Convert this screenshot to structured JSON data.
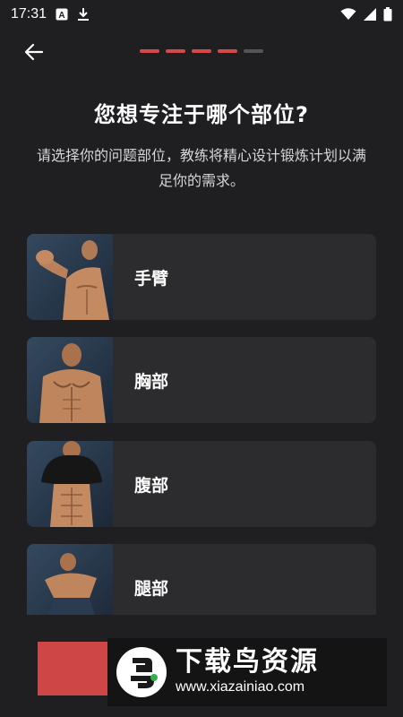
{
  "status_bar": {
    "time": "17:31",
    "left_icons": [
      "a-keyboard-icon",
      "download-icon"
    ],
    "right_icons": [
      "wifi-icon",
      "signal-icon",
      "battery-icon"
    ]
  },
  "progress": {
    "total_steps": 5,
    "current_step": 4,
    "active_color": "#d94848",
    "inactive_color": "#555555"
  },
  "heading": {
    "title": "您想专注于哪个部位?",
    "subtitle": "请选择你的问题部位，教练将精心设计锻炼计划以满足你的需求。"
  },
  "options": [
    {
      "label": "手臂",
      "image": "arm-flex-photo"
    },
    {
      "label": "胸部",
      "image": "chest-photo"
    },
    {
      "label": "腹部",
      "image": "abs-photo"
    },
    {
      "label": "腿部",
      "image": "legs-photo"
    }
  ],
  "ad": {
    "title": "下载鸟资源",
    "url": "www.xiazainiao.com"
  },
  "colors": {
    "background": "#1f1f21",
    "card": "#2c2c2e",
    "accent_red": "#cf4646"
  }
}
